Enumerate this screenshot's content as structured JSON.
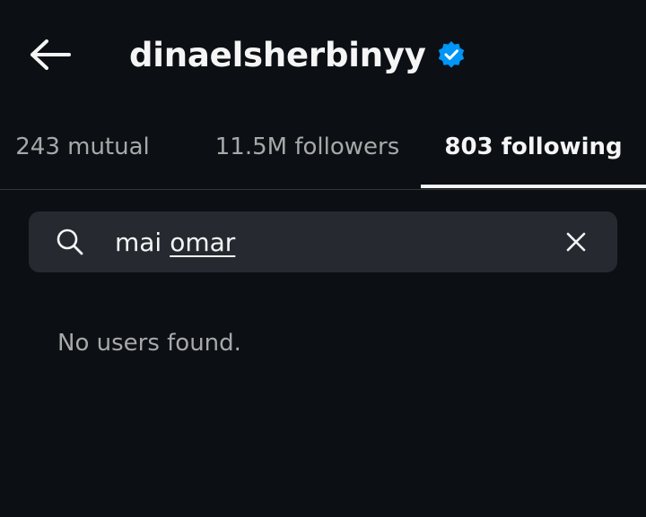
{
  "header": {
    "back_icon": "arrow-left-icon",
    "username": "dinaelsherbinyy",
    "verified_icon": "verified-badge-icon",
    "verified_color": "#0095f6"
  },
  "tabs": [
    {
      "label": "243 mutual",
      "active": false
    },
    {
      "label": "11.5M followers",
      "active": false
    },
    {
      "label": "803 following",
      "active": true
    }
  ],
  "search": {
    "icon": "search-icon",
    "value_first": "mai",
    "value_second": "omar",
    "clear_icon": "close-icon"
  },
  "results": {
    "empty_message": "No users found."
  },
  "colors": {
    "background": "#0c1014",
    "search_background": "#262a30",
    "primary_text": "#f5f5f5",
    "secondary_text": "#a8a8a8"
  }
}
